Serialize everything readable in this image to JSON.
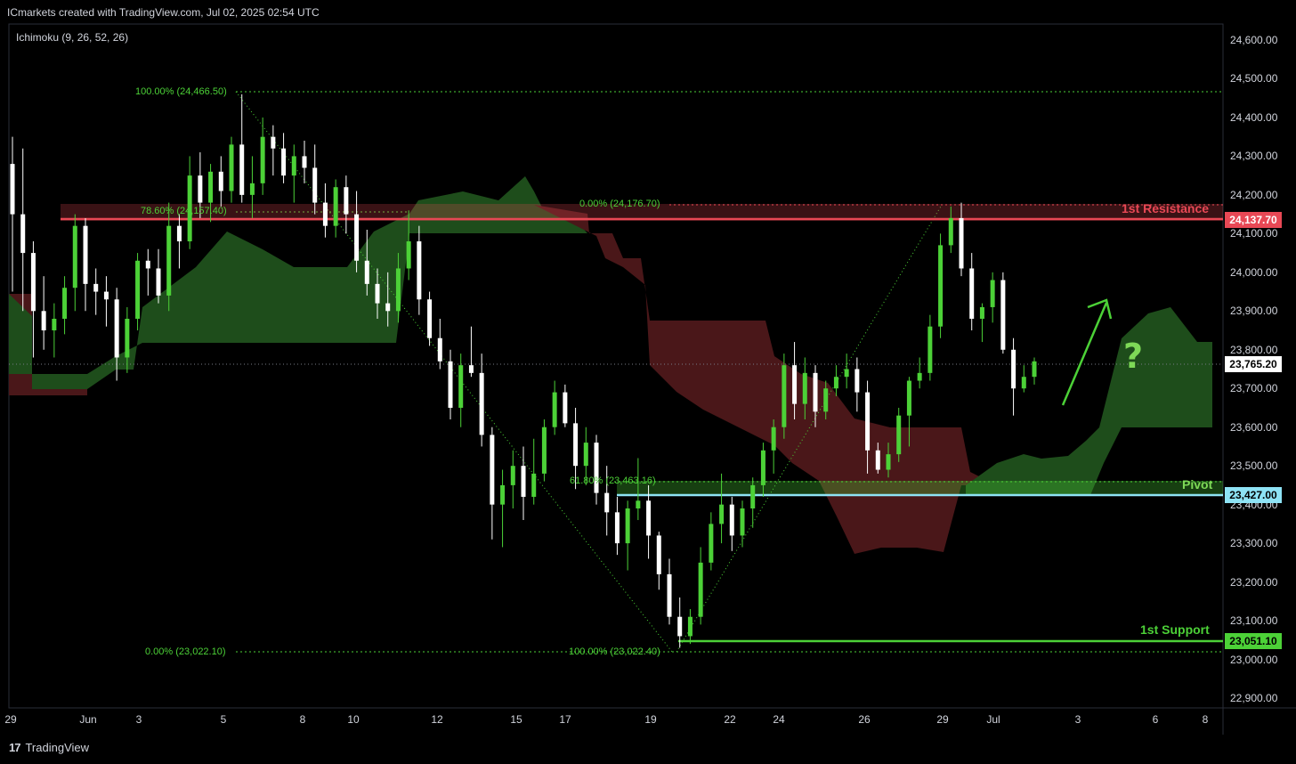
{
  "header": {
    "title": "ICmarkets created with TradingView.com, Jul 02, 2025 02:54 UTC",
    "indicator": "Ichimoku (9, 26, 52, 26)"
  },
  "footer": {
    "brand": "TradingView",
    "logo_text": "17"
  },
  "colors": {
    "bull": "#4cd137",
    "bear": "#ffffff",
    "cloud_bull": "#1e4d1b",
    "cloud_bear": "#4a1719",
    "resistance": "#e84855",
    "pivot": "#8ee3f5",
    "support": "#4cd137",
    "fib": "#4cd137"
  },
  "chart_data": {
    "type": "candlestick",
    "y_ticks": [
      "24,600.00",
      "24,500.00",
      "24,400.00",
      "24,300.00",
      "24,200.00",
      "24,100.00",
      "24,000.00",
      "23,900.00",
      "23,800.00",
      "23,700.00",
      "23,600.00",
      "23,500.00",
      "23,400.00",
      "23,300.00",
      "23,200.00",
      "23,100.00",
      "23,000.00",
      "22,900.00"
    ],
    "x_ticks": [
      "29",
      "Jun",
      "3",
      "5",
      "8",
      "10",
      "12",
      "15",
      "17",
      "19",
      "22",
      "24",
      "26",
      "29",
      "Jul",
      "3",
      "6",
      "8"
    ],
    "ylim": [
      22840,
      24660
    ],
    "levels": {
      "resistance": {
        "label": "1st Resistance",
        "value": 24137.7,
        "tag": "24,137.70"
      },
      "pivot": {
        "label": "Pivot",
        "value": 23427.0,
        "tag": "23,427.00"
      },
      "support": {
        "label": "1st Support",
        "value": 23051.1,
        "tag": "23,051.10"
      },
      "current": {
        "value": 23765.2,
        "tag": "23,765.20"
      }
    },
    "fib_labels": [
      {
        "text": "100.00% (24,466.50)",
        "value": 24466.5
      },
      {
        "text": "78.60% (24,157.40)",
        "value": 24157.4
      },
      {
        "text": "0.00% (23,022.10)",
        "value": 23022.1
      },
      {
        "text": "0.00% (24,176.70)",
        "value": 24176.7
      },
      {
        "text": "61.80% (23,463.16)",
        "value": 23463.16
      },
      {
        "text": "100.00% (23,022.40)",
        "value": 23022.4
      }
    ],
    "candles": [
      [
        24280,
        24350,
        23950,
        24150
      ],
      [
        24150,
        24320,
        23900,
        24050
      ],
      [
        24050,
        24080,
        23780,
        23900
      ],
      [
        23900,
        23990,
        23800,
        23850
      ],
      [
        23850,
        23920,
        23780,
        23880
      ],
      [
        23880,
        23990,
        23840,
        23960
      ],
      [
        23960,
        24150,
        23900,
        24120
      ],
      [
        24120,
        24140,
        23900,
        23970
      ],
      [
        23970,
        24010,
        23890,
        23950
      ],
      [
        23950,
        23990,
        23860,
        23930
      ],
      [
        23930,
        23960,
        23720,
        23780
      ],
      [
        23780,
        23910,
        23740,
        23880
      ],
      [
        23880,
        24050,
        23850,
        24030
      ],
      [
        24030,
        24060,
        23940,
        24010
      ],
      [
        24010,
        24060,
        23920,
        23940
      ],
      [
        23940,
        24180,
        23900,
        24120
      ],
      [
        24120,
        24150,
        24010,
        24080
      ],
      [
        24080,
        24300,
        24060,
        24250
      ],
      [
        24250,
        24310,
        24140,
        24180
      ],
      [
        24180,
        24280,
        24130,
        24260
      ],
      [
        24260,
        24300,
        24170,
        24210
      ],
      [
        24210,
        24350,
        24180,
        24330
      ],
      [
        24330,
        24460,
        24180,
        24200
      ],
      [
        24200,
        24300,
        24140,
        24230
      ],
      [
        24230,
        24400,
        24200,
        24350
      ],
      [
        24350,
        24380,
        24250,
        24320
      ],
      [
        24320,
        24360,
        24230,
        24250
      ],
      [
        24250,
        24330,
        24180,
        24300
      ],
      [
        24300,
        24340,
        24230,
        24270
      ],
      [
        24270,
        24330,
        24150,
        24180
      ],
      [
        24180,
        24230,
        24090,
        24120
      ],
      [
        24120,
        24240,
        24090,
        24220
      ],
      [
        24220,
        24250,
        24100,
        24150
      ],
      [
        24150,
        24210,
        24000,
        24030
      ],
      [
        24030,
        24110,
        23940,
        23970
      ],
      [
        23970,
        24010,
        23880,
        23920
      ],
      [
        23920,
        24000,
        23860,
        23900
      ],
      [
        23900,
        24050,
        23870,
        24010
      ],
      [
        24010,
        24160,
        23980,
        24080
      ],
      [
        24080,
        24120,
        23890,
        23930
      ],
      [
        23930,
        23950,
        23810,
        23830
      ],
      [
        23830,
        23880,
        23750,
        23770
      ],
      [
        23770,
        23800,
        23620,
        23650
      ],
      [
        23650,
        23790,
        23600,
        23760
      ],
      [
        23760,
        23860,
        23730,
        23740
      ],
      [
        23740,
        23790,
        23550,
        23580
      ],
      [
        23580,
        23600,
        23310,
        23400
      ],
      [
        23400,
        23490,
        23290,
        23450
      ],
      [
        23450,
        23540,
        23390,
        23500
      ],
      [
        23500,
        23550,
        23360,
        23420
      ],
      [
        23420,
        23570,
        23400,
        23480
      ],
      [
        23480,
        23620,
        23460,
        23600
      ],
      [
        23600,
        23720,
        23580,
        23690
      ],
      [
        23690,
        23710,
        23600,
        23610
      ],
      [
        23610,
        23650,
        23440,
        23500
      ],
      [
        23500,
        23600,
        23450,
        23560
      ],
      [
        23560,
        23580,
        23400,
        23430
      ],
      [
        23430,
        23500,
        23320,
        23380
      ],
      [
        23380,
        23420,
        23270,
        23300
      ],
      [
        23300,
        23410,
        23230,
        23390
      ],
      [
        23390,
        23520,
        23360,
        23410
      ],
      [
        23410,
        23450,
        23260,
        23320
      ],
      [
        23320,
        23330,
        23180,
        23220
      ],
      [
        23220,
        23260,
        23090,
        23110
      ],
      [
        23110,
        23160,
        23030,
        23060
      ],
      [
        23060,
        23130,
        23040,
        23110
      ],
      [
        23110,
        23290,
        23090,
        23250
      ],
      [
        23250,
        23380,
        23230,
        23350
      ],
      [
        23350,
        23480,
        23300,
        23400
      ],
      [
        23400,
        23420,
        23280,
        23320
      ],
      [
        23320,
        23410,
        23290,
        23390
      ],
      [
        23390,
        23470,
        23340,
        23450
      ],
      [
        23450,
        23560,
        23420,
        23540
      ],
      [
        23540,
        23620,
        23480,
        23600
      ],
      [
        23600,
        23790,
        23570,
        23760
      ],
      [
        23760,
        23820,
        23620,
        23660
      ],
      [
        23660,
        23780,
        23620,
        23740
      ],
      [
        23740,
        23760,
        23600,
        23640
      ],
      [
        23640,
        23720,
        23620,
        23700
      ],
      [
        23700,
        23760,
        23680,
        23730
      ],
      [
        23730,
        23790,
        23700,
        23750
      ],
      [
        23750,
        23780,
        23640,
        23690
      ],
      [
        23690,
        23720,
        23480,
        23540
      ],
      [
        23540,
        23560,
        23480,
        23490
      ],
      [
        23490,
        23560,
        23470,
        23530
      ],
      [
        23530,
        23650,
        23510,
        23630
      ],
      [
        23630,
        23730,
        23550,
        23720
      ],
      [
        23720,
        23780,
        23700,
        23740
      ],
      [
        23740,
        23890,
        23720,
        23860
      ],
      [
        23860,
        24100,
        23830,
        24070
      ],
      [
        24070,
        24170,
        24050,
        24140
      ],
      [
        24140,
        24180,
        23990,
        24010
      ],
      [
        24010,
        24050,
        23850,
        23880
      ],
      [
        23880,
        23920,
        23820,
        23910
      ],
      [
        23910,
        24000,
        23870,
        23980
      ],
      [
        23980,
        24000,
        23790,
        23800
      ],
      [
        23800,
        23830,
        23630,
        23700
      ],
      [
        23700,
        23760,
        23690,
        23730
      ],
      [
        23730,
        23780,
        23710,
        23770
      ]
    ]
  }
}
